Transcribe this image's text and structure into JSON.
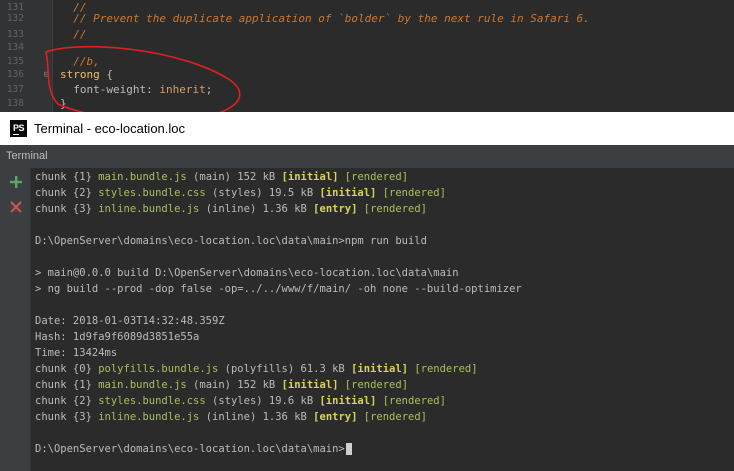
{
  "editor": {
    "lines": [
      {
        "num": "131",
        "text": "  //"
      },
      {
        "num": "132",
        "text": "  // Prevent the duplicate application of `bolder` by the next rule in Safari 6."
      },
      {
        "num": "133",
        "text": "  //"
      },
      {
        "num": "134",
        "text": ""
      },
      {
        "num": "135",
        "text": "  //b,"
      },
      {
        "num": "136",
        "selector": "strong",
        "brace": " {"
      },
      {
        "num": "137",
        "property": "  font-weight: ",
        "value": "inherit",
        "semi": ";"
      },
      {
        "num": "138",
        "text": "}"
      }
    ]
  },
  "window": {
    "app_icon": "PS",
    "title": "Terminal - eco-location.loc"
  },
  "panel": {
    "header": "Terminal"
  },
  "toolbar": {
    "add_icon": "plus-icon",
    "close_icon": "close-icon",
    "colors": {
      "add": "#59a869",
      "close": "#c75450"
    }
  },
  "terminal": {
    "l1": {
      "a": "chunk {1} ",
      "b": "main.bundle.js",
      "c": " (main) 152 kB ",
      "d": "[initial]",
      "e": " ",
      "f": "[rendered]"
    },
    "l2": {
      "a": "chunk {2} ",
      "b": "styles.bundle.css",
      "c": " (styles) 19.5 kB ",
      "d": "[initial]",
      "e": " ",
      "f": "[rendered]"
    },
    "l3": {
      "a": "chunk {3} ",
      "b": "inline.bundle.js",
      "c": " (inline) 1.36 kB ",
      "d": "[entry]",
      "e": " ",
      "f": "[rendered]"
    },
    "prompt1": "D:\\OpenServer\\domains\\eco-location.loc\\data\\main>npm run build",
    "npm1": "> main@0.0.0 build D:\\OpenServer\\domains\\eco-location.loc\\data\\main",
    "npm2": "> ng build --prod -dop false -op=../../www/f/main/ -oh none --build-optimizer",
    "date": "Date: 2018-01-03T14:32:48.359Z",
    "hash": "Hash: 1d9fa9f6089d3851e55a",
    "time": "Time: 13424ms",
    "l4": {
      "a": "chunk {0} ",
      "b": "polyfills.bundle.js",
      "c": " (polyfills) 61.3 kB ",
      "d": "[initial]",
      "e": " ",
      "f": "[rendered]"
    },
    "l5": {
      "a": "chunk {1} ",
      "b": "main.bundle.js",
      "c": " (main) 152 kB ",
      "d": "[initial]",
      "e": " ",
      "f": "[rendered]"
    },
    "l6": {
      "a": "chunk {2} ",
      "b": "styles.bundle.css",
      "c": " (styles) 19.6 kB ",
      "d": "[initial]",
      "e": " ",
      "f": "[rendered]"
    },
    "l7": {
      "a": "chunk {3} ",
      "b": "inline.bundle.js",
      "c": " (inline) 1.36 kB ",
      "d": "[entry]",
      "e": " ",
      "f": "[rendered]"
    },
    "prompt2": "D:\\OpenServer\\domains\\eco-location.loc\\data\\main>"
  },
  "colors": {
    "editor_bg": "#2b2b2b",
    "terminal_bg": "#2b2b2b",
    "comment": "#cc7832",
    "filename_green": "#a5c25c",
    "flag_yellow": "#d8d35f",
    "annotation_red": "#e02020"
  }
}
